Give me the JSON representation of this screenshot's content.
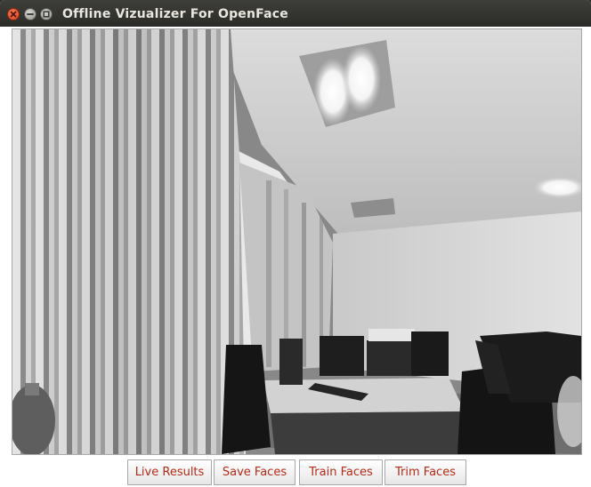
{
  "window": {
    "title": "Offline Vizualizer For OpenFace",
    "controls": [
      "close-icon",
      "minimize-icon",
      "maximize-icon"
    ]
  },
  "viewer": {
    "content": "grayscale webcam frame"
  },
  "toolbar": {
    "buttons": [
      {
        "label": "Live Results"
      },
      {
        "label": "Save Faces"
      },
      {
        "label": "Train Faces"
      },
      {
        "label": "Trim Faces"
      }
    ]
  },
  "colors": {
    "titlebar": "#2d2d2a",
    "button_text": "#b72a14",
    "close_button": "#e0512a"
  }
}
